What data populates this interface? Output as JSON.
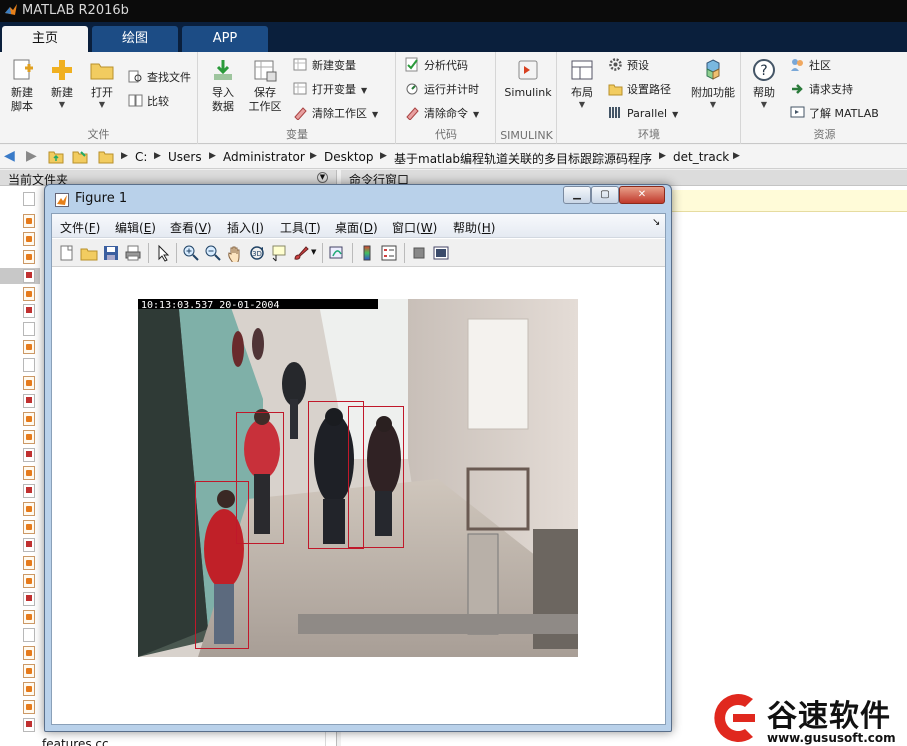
{
  "window": {
    "title": "MATLAB R2016b"
  },
  "ribbon_tabs": [
    {
      "label": "主页",
      "active": true
    },
    {
      "label": "绘图",
      "active": false
    },
    {
      "label": "APP",
      "active": false
    }
  ],
  "ribbon": {
    "file": {
      "group_label": "文件",
      "new_script": [
        "新建",
        "脚本"
      ],
      "new": "新建",
      "open": "打开",
      "find_files": "查找文件",
      "compare": "比较"
    },
    "variable": {
      "group_label": "变量",
      "import_data": [
        "导入",
        "数据"
      ],
      "save_workspace": [
        "保存",
        "工作区"
      ],
      "new_variable": "新建变量",
      "open_variable": "打开变量",
      "clear_workspace": "清除工作区"
    },
    "code": {
      "group_label": "代码",
      "analyze_code": "分析代码",
      "run_and_time": "运行并计时",
      "clear_commands": "清除命令"
    },
    "simulink": {
      "group_label": "SIMULINK",
      "simulink": "Simulink"
    },
    "environment": {
      "group_label": "环境",
      "layout": "布局",
      "preferences": "预设",
      "set_path": "设置路径",
      "parallel": "Parallel",
      "addons": "附加功能"
    },
    "resources": {
      "group_label": "资源",
      "help": "帮助",
      "community": "社区",
      "request_support": "请求支持",
      "learn_matlab": "了解 MATLAB"
    }
  },
  "address_bar": {
    "path": [
      "C:",
      "Users",
      "Administrator",
      "Desktop",
      "基于matlab编程轨道关联的多目标跟踪源码程序",
      "det_track"
    ]
  },
  "current_folder": {
    "title": "当前文件夹",
    "visible_last_file": "features.cc"
  },
  "command_window": {
    "title": "命令行窗口"
  },
  "figure": {
    "title": "Figure 1",
    "menu": [
      {
        "label": "文件",
        "key": "F"
      },
      {
        "label": "编辑",
        "key": "E"
      },
      {
        "label": "查看",
        "key": "V"
      },
      {
        "label": "插入",
        "key": "I"
      },
      {
        "label": "工具",
        "key": "T"
      },
      {
        "label": "桌面",
        "key": "D"
      },
      {
        "label": "窗口",
        "key": "W"
      },
      {
        "label": "帮助",
        "key": "H"
      }
    ],
    "video_timestamp": "10:13:03.537  20-01-2004",
    "tracked_targets": 4
  },
  "watermark": {
    "brand": "谷速软件",
    "url": "www.gususoft.com"
  }
}
